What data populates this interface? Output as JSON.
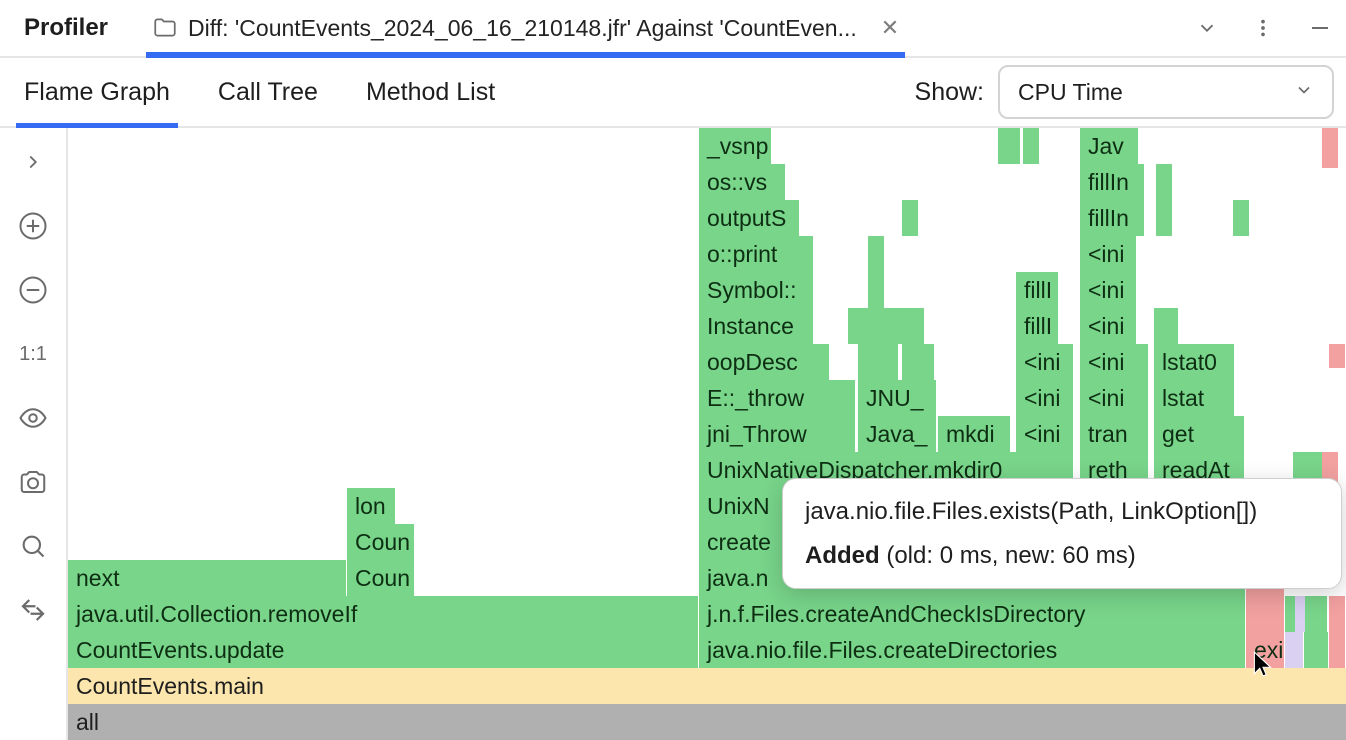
{
  "header": {
    "profiler_label": "Profiler",
    "file_tab_text": "Diff: 'CountEvents_2024_06_16_210148.jfr' Against 'CountEven..."
  },
  "subtabs": {
    "flame": "Flame Graph",
    "calltree": "Call Tree",
    "methodlist": "Method List"
  },
  "show": {
    "label": "Show:",
    "selected": "CPU Time"
  },
  "side_1to1": "1:1",
  "tooltip": {
    "title": "java.nio.file.Files.exists(Path, LinkOption[])",
    "added_label": "Added",
    "added_rest": " (old: 0 ms, new: 60 ms)"
  },
  "flame": {
    "all": "all",
    "main": "CountEvents.main",
    "update": "CountEvents.update",
    "removeIf": "java.util.Collection.removeIf",
    "next": "next",
    "coun1": "Coun",
    "coun2": "Coun",
    "lon": "lon",
    "createDirs": "java.nio.file.Files.createDirectories",
    "checkDir": "j.n.f.Files.createAndCheckIsDirectory",
    "javan": "java.n",
    "create": "create",
    "unixN": "UnixN",
    "unixDisp": "UnixNativeDispatcher.mkdir0",
    "jniThrow": "jni_Throw",
    "eThrow": "E::_throw",
    "oopDesc": "oopDesc",
    "instance": "Instance",
    "symbol": "Symbol::",
    "oprint": "o::print",
    "outputS": "outputS",
    "osvs": "os::vs",
    "vsnp": "_vsnp",
    "javaM": "Java_",
    "jnum": "JNU_",
    "mkdi": "mkdi",
    "reth": "reth",
    "ini": "<ini",
    "fillI": "fillI",
    "fillIn": "fillIn",
    "jav": "Jav",
    "tran": "tran",
    "readAt": "readAt",
    "get": "get",
    "lstat": "lstat",
    "lstat0": "lstat0",
    "exi": "exi"
  }
}
